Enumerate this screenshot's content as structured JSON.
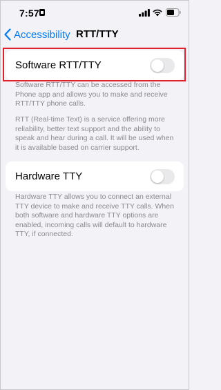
{
  "status_bar": {
    "time": "7:57",
    "icons": [
      "lock-icon",
      "signal-icon",
      "wifi-icon",
      "battery-icon"
    ]
  },
  "nav": {
    "back_label": "Accessibility",
    "title": "RTT/TTY"
  },
  "software": {
    "label": "Software RTT/TTY",
    "toggle_on": false,
    "description_1": "Software RTT/TTY can be accessed from the Phone app and allows you to make and receive RTT/TTY phone calls.",
    "description_2": "RTT (Real-time Text) is a service offering more reliability, better text support and the ability to speak and hear during a call. It will be used when it is available based on carrier support."
  },
  "hardware": {
    "label": "Hardware TTY",
    "toggle_on": false,
    "description": "Hardware TTY allows you to connect an external TTY device to make and receive TTY calls. When both software and hardware TTY options are enabled, incoming calls will default to hardware TTY, if connected."
  },
  "colors": {
    "accent": "#007aff",
    "background": "#f2f2f7",
    "toggle_off": "#e9e9eb",
    "highlight": "#e0202a",
    "footer_text": "#8a8a8e"
  }
}
